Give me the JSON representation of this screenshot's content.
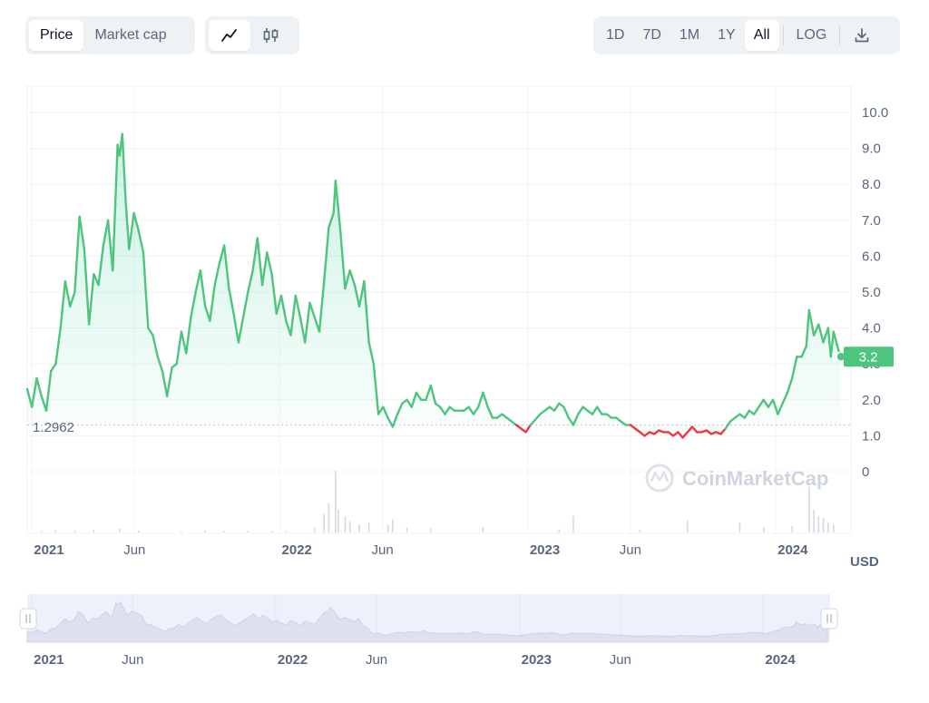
{
  "controls": {
    "metric_tabs": [
      {
        "label": "Price",
        "active": true
      },
      {
        "label": "Market cap",
        "active": false
      }
    ],
    "chart_types": [
      {
        "icon": "line-chart-icon",
        "active": true
      },
      {
        "icon": "candlestick-icon",
        "active": false
      }
    ],
    "ranges": [
      {
        "label": "1D",
        "active": false
      },
      {
        "label": "7D",
        "active": false
      },
      {
        "label": "1M",
        "active": false
      },
      {
        "label": "1Y",
        "active": false
      },
      {
        "label": "All",
        "active": true
      }
    ],
    "log_label": "LOG",
    "download_icon": "download-icon"
  },
  "watermark": "CoinMarketCap",
  "currency_label": "USD",
  "current_price_label": "3.2",
  "baseline_label": "1.2962",
  "colors": {
    "up": "#16c784",
    "line_up": "#4fc47f",
    "down": "#ea3943",
    "grid": "#f1f3f6",
    "badge": "#4fc47f"
  },
  "chart_data": {
    "type": "line",
    "title": "",
    "xlabel": "",
    "ylabel": "USD",
    "x_range": [
      "2020-12-25",
      "2024-04-10"
    ],
    "ylim": [
      0,
      10
    ],
    "y_ticks": [
      "0",
      "1.0",
      "2.0",
      "3.0",
      "4.0",
      "5.0",
      "6.0",
      "7.0",
      "8.0",
      "9.0",
      "10.0"
    ],
    "x_ticks": [
      {
        "label": "2021",
        "date": "2021-01-01",
        "bold": true
      },
      {
        "label": "Jun",
        "date": "2021-06-01",
        "bold": false
      },
      {
        "label": "2022",
        "date": "2022-01-01",
        "bold": true
      },
      {
        "label": "Jun",
        "date": "2022-06-01",
        "bold": false
      },
      {
        "label": "2023",
        "date": "2023-01-01",
        "bold": true
      },
      {
        "label": "Jun",
        "date": "2023-06-01",
        "bold": false
      },
      {
        "label": "2024",
        "date": "2024-01-01",
        "bold": true
      }
    ],
    "baseline": 1.2962,
    "series": [
      {
        "name": "",
        "points": [
          [
            "2020-12-25",
            2.3
          ],
          [
            "2021-01-01",
            1.8
          ],
          [
            "2021-01-08",
            2.6
          ],
          [
            "2021-01-15",
            2.1
          ],
          [
            "2021-01-22",
            1.7
          ],
          [
            "2021-01-29",
            2.8
          ],
          [
            "2021-02-05",
            3.0
          ],
          [
            "2021-02-12",
            4.0
          ],
          [
            "2021-02-19",
            5.3
          ],
          [
            "2021-02-26",
            4.6
          ],
          [
            "2021-03-05",
            5.0
          ],
          [
            "2021-03-12",
            7.1
          ],
          [
            "2021-03-19",
            6.2
          ],
          [
            "2021-03-26",
            4.1
          ],
          [
            "2021-04-02",
            5.5
          ],
          [
            "2021-04-09",
            5.2
          ],
          [
            "2021-04-16",
            6.3
          ],
          [
            "2021-04-23",
            7.0
          ],
          [
            "2021-04-30",
            5.6
          ],
          [
            "2021-05-07",
            9.1
          ],
          [
            "2021-05-10",
            8.8
          ],
          [
            "2021-05-14",
            9.4
          ],
          [
            "2021-05-19",
            7.5
          ],
          [
            "2021-05-24",
            6.2
          ],
          [
            "2021-05-31",
            7.2
          ],
          [
            "2021-06-07",
            6.7
          ],
          [
            "2021-06-14",
            6.1
          ],
          [
            "2021-06-21",
            4.0
          ],
          [
            "2021-06-28",
            3.8
          ],
          [
            "2021-07-05",
            3.2
          ],
          [
            "2021-07-12",
            2.8
          ],
          [
            "2021-07-19",
            2.1
          ],
          [
            "2021-07-26",
            2.9
          ],
          [
            "2021-08-02",
            3.0
          ],
          [
            "2021-08-09",
            3.9
          ],
          [
            "2021-08-16",
            3.3
          ],
          [
            "2021-08-23",
            4.3
          ],
          [
            "2021-08-30",
            5.0
          ],
          [
            "2021-09-06",
            5.6
          ],
          [
            "2021-09-13",
            4.6
          ],
          [
            "2021-09-20",
            4.2
          ],
          [
            "2021-09-27",
            5.2
          ],
          [
            "2021-10-04",
            5.8
          ],
          [
            "2021-10-11",
            6.3
          ],
          [
            "2021-10-18",
            5.1
          ],
          [
            "2021-10-25",
            4.4
          ],
          [
            "2021-11-01",
            3.6
          ],
          [
            "2021-11-08",
            4.3
          ],
          [
            "2021-11-15",
            5.0
          ],
          [
            "2021-11-22",
            5.6
          ],
          [
            "2021-11-29",
            6.5
          ],
          [
            "2021-12-06",
            5.2
          ],
          [
            "2021-12-13",
            6.1
          ],
          [
            "2021-12-20",
            5.5
          ],
          [
            "2021-12-27",
            4.4
          ],
          [
            "2022-01-03",
            4.9
          ],
          [
            "2022-01-10",
            4.2
          ],
          [
            "2022-01-17",
            3.8
          ],
          [
            "2022-01-24",
            4.9
          ],
          [
            "2022-01-31",
            4.3
          ],
          [
            "2022-02-07",
            3.6
          ],
          [
            "2022-02-14",
            4.7
          ],
          [
            "2022-02-21",
            4.3
          ],
          [
            "2022-02-28",
            3.9
          ],
          [
            "2022-03-07",
            5.3
          ],
          [
            "2022-03-14",
            6.8
          ],
          [
            "2022-03-21",
            7.2
          ],
          [
            "2022-03-24",
            8.1
          ],
          [
            "2022-03-31",
            6.7
          ],
          [
            "2022-04-07",
            5.1
          ],
          [
            "2022-04-14",
            5.6
          ],
          [
            "2022-04-21",
            5.2
          ],
          [
            "2022-04-28",
            4.6
          ],
          [
            "2022-05-05",
            5.3
          ],
          [
            "2022-05-12",
            3.6
          ],
          [
            "2022-05-19",
            3.0
          ],
          [
            "2022-05-26",
            1.6
          ],
          [
            "2022-06-02",
            1.8
          ],
          [
            "2022-06-09",
            1.5
          ],
          [
            "2022-06-16",
            1.25
          ],
          [
            "2022-06-23",
            1.6
          ],
          [
            "2022-06-30",
            1.9
          ],
          [
            "2022-07-07",
            2.0
          ],
          [
            "2022-07-14",
            1.8
          ],
          [
            "2022-07-21",
            2.2
          ],
          [
            "2022-07-28",
            2.0
          ],
          [
            "2022-08-04",
            2.0
          ],
          [
            "2022-08-11",
            2.4
          ],
          [
            "2022-08-18",
            1.9
          ],
          [
            "2022-08-25",
            1.8
          ],
          [
            "2022-09-01",
            1.6
          ],
          [
            "2022-09-08",
            1.8
          ],
          [
            "2022-09-15",
            1.7
          ],
          [
            "2022-09-22",
            1.7
          ],
          [
            "2022-09-29",
            1.7
          ],
          [
            "2022-10-06",
            1.8
          ],
          [
            "2022-10-13",
            1.6
          ],
          [
            "2022-10-20",
            1.8
          ],
          [
            "2022-10-27",
            2.2
          ],
          [
            "2022-11-03",
            1.8
          ],
          [
            "2022-11-10",
            1.5
          ],
          [
            "2022-11-17",
            1.5
          ],
          [
            "2022-11-24",
            1.6
          ],
          [
            "2022-12-01",
            1.5
          ],
          [
            "2022-12-08",
            1.4
          ],
          [
            "2022-12-15",
            1.3
          ],
          [
            "2022-12-22",
            1.2
          ],
          [
            "2022-12-29",
            1.1
          ],
          [
            "2023-01-05",
            1.3
          ],
          [
            "2023-01-12",
            1.45
          ],
          [
            "2023-01-19",
            1.6
          ],
          [
            "2023-01-26",
            1.7
          ],
          [
            "2023-02-02",
            1.8
          ],
          [
            "2023-02-09",
            1.7
          ],
          [
            "2023-02-16",
            1.9
          ],
          [
            "2023-02-23",
            1.8
          ],
          [
            "2023-03-02",
            1.5
          ],
          [
            "2023-03-09",
            1.3
          ],
          [
            "2023-03-16",
            1.6
          ],
          [
            "2023-03-23",
            1.8
          ],
          [
            "2023-03-30",
            1.7
          ],
          [
            "2023-04-06",
            1.6
          ],
          [
            "2023-04-13",
            1.8
          ],
          [
            "2023-04-20",
            1.6
          ],
          [
            "2023-04-27",
            1.6
          ],
          [
            "2023-05-04",
            1.5
          ],
          [
            "2023-05-11",
            1.5
          ],
          [
            "2023-05-18",
            1.4
          ],
          [
            "2023-05-25",
            1.3
          ],
          [
            "2023-06-01",
            1.3
          ],
          [
            "2023-06-08",
            1.2
          ],
          [
            "2023-06-15",
            1.1
          ],
          [
            "2023-06-22",
            1.0
          ],
          [
            "2023-06-29",
            1.1
          ],
          [
            "2023-07-06",
            1.05
          ],
          [
            "2023-07-13",
            1.15
          ],
          [
            "2023-07-20",
            1.1
          ],
          [
            "2023-07-27",
            1.1
          ],
          [
            "2023-08-03",
            1.0
          ],
          [
            "2023-08-10",
            1.1
          ],
          [
            "2023-08-17",
            0.95
          ],
          [
            "2023-08-24",
            1.1
          ],
          [
            "2023-08-31",
            1.25
          ],
          [
            "2023-09-07",
            1.1
          ],
          [
            "2023-09-14",
            1.1
          ],
          [
            "2023-09-21",
            1.15
          ],
          [
            "2023-09-28",
            1.05
          ],
          [
            "2023-10-05",
            1.1
          ],
          [
            "2023-10-12",
            1.05
          ],
          [
            "2023-10-19",
            1.2
          ],
          [
            "2023-10-26",
            1.4
          ],
          [
            "2023-11-02",
            1.5
          ],
          [
            "2023-11-09",
            1.6
          ],
          [
            "2023-11-16",
            1.5
          ],
          [
            "2023-11-23",
            1.7
          ],
          [
            "2023-11-30",
            1.6
          ],
          [
            "2023-12-07",
            1.8
          ],
          [
            "2023-12-14",
            2.0
          ],
          [
            "2023-12-21",
            1.8
          ],
          [
            "2023-12-28",
            2.0
          ],
          [
            "2024-01-04",
            1.6
          ],
          [
            "2024-01-11",
            1.9
          ],
          [
            "2024-01-18",
            2.2
          ],
          [
            "2024-01-25",
            2.6
          ],
          [
            "2024-02-01",
            3.2
          ],
          [
            "2024-02-08",
            3.2
          ],
          [
            "2024-02-15",
            3.5
          ],
          [
            "2024-02-19",
            4.5
          ],
          [
            "2024-02-26",
            3.8
          ],
          [
            "2024-03-04",
            4.1
          ],
          [
            "2024-03-11",
            3.6
          ],
          [
            "2024-03-18",
            4.0
          ],
          [
            "2024-03-22",
            3.2
          ],
          [
            "2024-03-26",
            3.9
          ],
          [
            "2024-04-02",
            3.4
          ],
          [
            "2024-04-06",
            3.2
          ]
        ]
      }
    ],
    "volume": [
      [
        "2021-01-15",
        0.02
      ],
      [
        "2021-02-05",
        0.04
      ],
      [
        "2021-03-05",
        0.03
      ],
      [
        "2021-04-02",
        0.04
      ],
      [
        "2021-05-10",
        0.06
      ],
      [
        "2021-06-07",
        0.03
      ],
      [
        "2021-08-09",
        0.02
      ],
      [
        "2021-09-13",
        0.03
      ],
      [
        "2021-10-11",
        0.02
      ],
      [
        "2021-11-15",
        0.03
      ],
      [
        "2021-12-20",
        0.02
      ],
      [
        "2022-01-10",
        0.02
      ],
      [
        "2022-02-21",
        0.08
      ],
      [
        "2022-03-07",
        0.28
      ],
      [
        "2022-03-14",
        0.45
      ],
      [
        "2022-03-24",
        0.95
      ],
      [
        "2022-03-28",
        0.35
      ],
      [
        "2022-04-07",
        0.25
      ],
      [
        "2022-04-14",
        0.18
      ],
      [
        "2022-04-28",
        0.12
      ],
      [
        "2022-05-12",
        0.15
      ],
      [
        "2022-06-09",
        0.12
      ],
      [
        "2022-06-16",
        0.2
      ],
      [
        "2022-07-07",
        0.08
      ],
      [
        "2022-08-11",
        0.06
      ],
      [
        "2022-10-27",
        0.08
      ],
      [
        "2023-02-16",
        0.05
      ],
      [
        "2023-03-09",
        0.25
      ],
      [
        "2023-06-15",
        0.04
      ],
      [
        "2023-08-24",
        0.18
      ],
      [
        "2023-11-09",
        0.15
      ],
      [
        "2023-12-14",
        0.08
      ],
      [
        "2024-01-25",
        0.1
      ],
      [
        "2024-02-19",
        0.7
      ],
      [
        "2024-02-26",
        0.35
      ],
      [
        "2024-03-04",
        0.25
      ],
      [
        "2024-03-11",
        0.22
      ],
      [
        "2024-03-18",
        0.15
      ],
      [
        "2024-03-26",
        0.12
      ]
    ]
  }
}
